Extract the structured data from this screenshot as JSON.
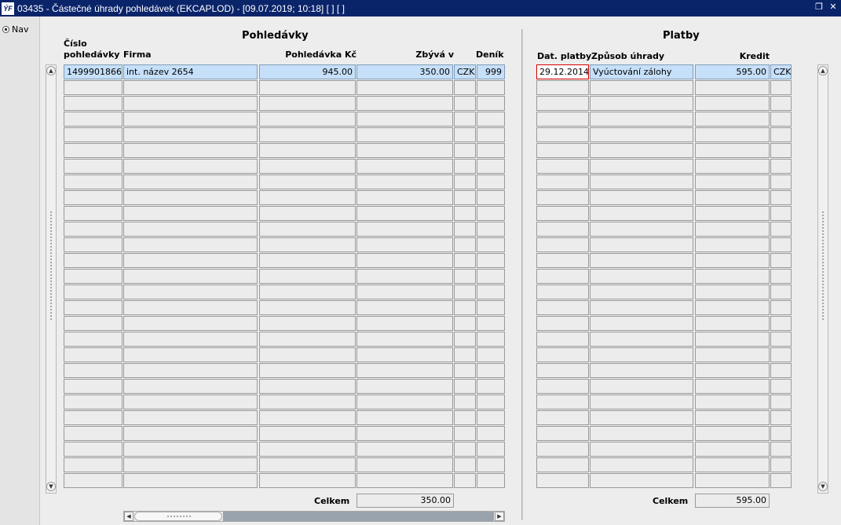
{
  "window": {
    "app_icon": "ÝF",
    "title": "03435 - Částečné úhrady pohledávek (EKCAPLOD) - [09.07.2019; 10:18]  [ ]  [ ]",
    "controls": [
      "restore-icon",
      "close-icon"
    ],
    "title_bg": "#0a246a"
  },
  "nav": {
    "label": "Nav"
  },
  "left_section": {
    "title": "Pohledávky",
    "headers": {
      "cislo_line1": "Číslo",
      "cislo_line2": "pohledávky",
      "firma": "Firma",
      "pohledavka": "Pohledávka Kč",
      "zbyva": "Zbývá v",
      "denik": "Deník"
    },
    "rows": [
      {
        "cislo": "1499901866",
        "firma": "int. název 2654",
        "pohledavka": "945.00",
        "zbyva": "350.00",
        "mena": "CZK",
        "denik": "999"
      }
    ],
    "total_label": "Celkem",
    "total_value": "350.00"
  },
  "right_section": {
    "title": "Platby",
    "headers": {
      "dat_platby": "Dat. platby",
      "zpusob": "Způsob úhrady",
      "kredit": "Kredit"
    },
    "rows": [
      {
        "dat_platby": "29.12.2014",
        "zpusob": "Vyúctování zálohy",
        "kredit": "595.00",
        "mena": "CZK"
      }
    ],
    "total_label": "Celkem",
    "total_value": "595.00"
  },
  "colors": {
    "selected_row": "#c6e0fa",
    "focus_border": "#d20000",
    "cell_bg": "#ececec"
  }
}
